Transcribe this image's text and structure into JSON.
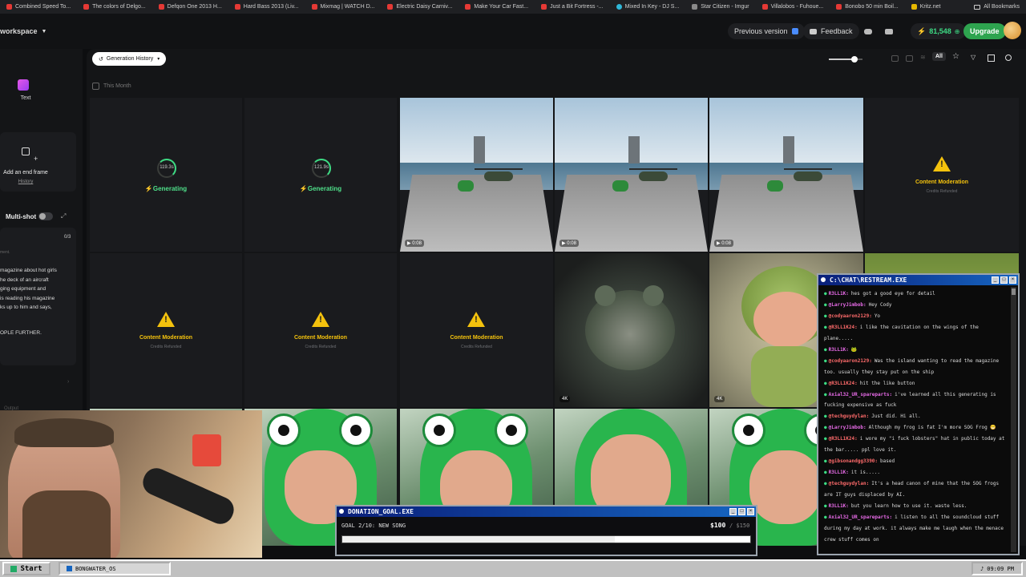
{
  "bookmarks": [
    {
      "label": "Combined Speed To...",
      "icon": "youtube-icon"
    },
    {
      "label": "The colors of Delgo...",
      "icon": "youtube-icon"
    },
    {
      "label": "Defqon One 2013 H...",
      "icon": "youtube-icon"
    },
    {
      "label": "Hard Bass 2013 (Liv...",
      "icon": "youtube-icon"
    },
    {
      "label": "Mixmag | WATCH D...",
      "icon": "youtube-icon"
    },
    {
      "label": "Electric Daisy Carniv...",
      "icon": "youtube-icon"
    },
    {
      "label": "Make Your Car Fast...",
      "icon": "youtube-icon"
    },
    {
      "label": "Just a Bit Fortress -...",
      "icon": "youtube-icon"
    },
    {
      "label": "Mixed In Key - DJ S...",
      "icon": "mixedinkey-icon"
    },
    {
      "label": "Star Citizen - Imgur",
      "icon": "imgur-icon"
    },
    {
      "label": "Villalobos - Fuhoue...",
      "icon": "youtube-icon"
    },
    {
      "label": "Bonobo 50 min Boil...",
      "icon": "youtube-icon"
    },
    {
      "label": "Kritz.net",
      "icon": "kritz-icon"
    }
  ],
  "all_bookmarks": "All Bookmarks",
  "header": {
    "workspace": "workspace",
    "previous_version": "Previous version",
    "feedback": "Feedback",
    "credits": "81,548",
    "upgrade": "Upgrade"
  },
  "sidebar": {
    "text_label": "Text",
    "end_frame": "Add an end frame",
    "history": "History",
    "multishot": "Multi-shot",
    "counter": "0/3",
    "prompt_hint": "ment.",
    "prompt_text": "magazine about hot girls\nhe deck of an aircraft\nging equipment and\n is reading his magazine\nks up to him and says,",
    "prompt_text2": "OPLE FURTHER.",
    "output": "Output"
  },
  "main": {
    "history_dropdown": "Generation History",
    "filter_all": "All",
    "month_label": "This Month",
    "slider_value": 0.75
  },
  "tiles_row1": [
    {
      "type": "generating",
      "time": "119.3s",
      "label": "Generating"
    },
    {
      "type": "generating",
      "time": "121.9s",
      "label": "Generating"
    },
    {
      "type": "video",
      "duration": "0:08"
    },
    {
      "type": "video",
      "duration": "0:08"
    },
    {
      "type": "video",
      "duration": "0:08"
    },
    {
      "type": "moderation",
      "label": "Content Moderation",
      "sub": "Credits Refunded"
    }
  ],
  "tiles_row2": [
    {
      "type": "moderation",
      "label": "Content Moderation",
      "sub": "Credits Refunded"
    },
    {
      "type": "moderation",
      "label": "Content Moderation",
      "sub": "Credits Refunded"
    },
    {
      "type": "moderation",
      "label": "Content Moderation",
      "sub": "Credits Refunded"
    },
    {
      "type": "image",
      "badge": "4K"
    },
    {
      "type": "image",
      "badge": "4K"
    }
  ],
  "chat": {
    "title": "C:\\CHAT\\RESTREAM.EXE",
    "messages": [
      {
        "user": "R3LL1K:",
        "text": "hes got a good eye for detail",
        "color": "#e86be8"
      },
      {
        "user": "@LarryJimbob:",
        "text": "Hey Cody",
        "color": "#e86be8"
      },
      {
        "user": "@codyaaron2129:",
        "text": "Yo",
        "color": "#ff6b6b"
      },
      {
        "user": "@R3LL1K24:",
        "text": "i like the cavitation on the wings of the plane.....",
        "color": "#ff6b6b"
      },
      {
        "user": "R3LL1K:",
        "text": "🐸",
        "color": "#e86be8"
      },
      {
        "user": "@codyaaron2129:",
        "text": "Was the island wanting to read the magazine too. usually they stay put on the ship",
        "color": "#ff6b6b"
      },
      {
        "user": "@R3LL1K24:",
        "text": "hit the like button",
        "color": "#ff6b6b"
      },
      {
        "user": "Axial32_UR_spareparts:",
        "text": "i've learned all this generating is fucking expensive as fuck",
        "color": "#e86be8"
      },
      {
        "user": "@techguydylan:",
        "text": "Just did. Hi all.",
        "color": "#ff6b6b"
      },
      {
        "user": "@LarryJimbob:",
        "text": "Although my frog is fat I'm more SOG Frog 😁",
        "color": "#e86be8"
      },
      {
        "user": "@R3LL1K24:",
        "text": "i wore my \"i fuck lobsters\" hat in public today at the bar..... ppl love it.",
        "color": "#ff6b6b"
      },
      {
        "user": "@gibsonandgg3390:",
        "text": "based",
        "color": "#ff6b6b"
      },
      {
        "user": "R3LL1K:",
        "text": "it is.....",
        "color": "#e86be8"
      },
      {
        "user": "@techguydylan:",
        "text": "It's a head canon of mine that the SOG frogs are IT guys displaced by AI.",
        "color": "#ff6b6b"
      },
      {
        "user": "R3LL1K:",
        "text": "but you learn how to use it. waste less.",
        "color": "#e86be8"
      },
      {
        "user": "Axial32_UR_spareparts:",
        "text": "i listen to all the soundcloud stuff during my day at work. it always make me laugh when the menace crew stuff comes on",
        "color": "#e86be8"
      }
    ]
  },
  "donation": {
    "title": "DONATION_GOAL.EXE",
    "goal": "GOAL 2/10: NEW SONG",
    "raised": "$100",
    "target": "/ $150",
    "progress": 0.667
  },
  "taskbar": {
    "start": "Start",
    "task": "BONGWATER_OS",
    "clock": "09:09 PM"
  },
  "colors": {
    "accent_green": "#3ddc84",
    "warning_yellow": "#f4c20d",
    "upgrade_green": "#2ea44f"
  }
}
